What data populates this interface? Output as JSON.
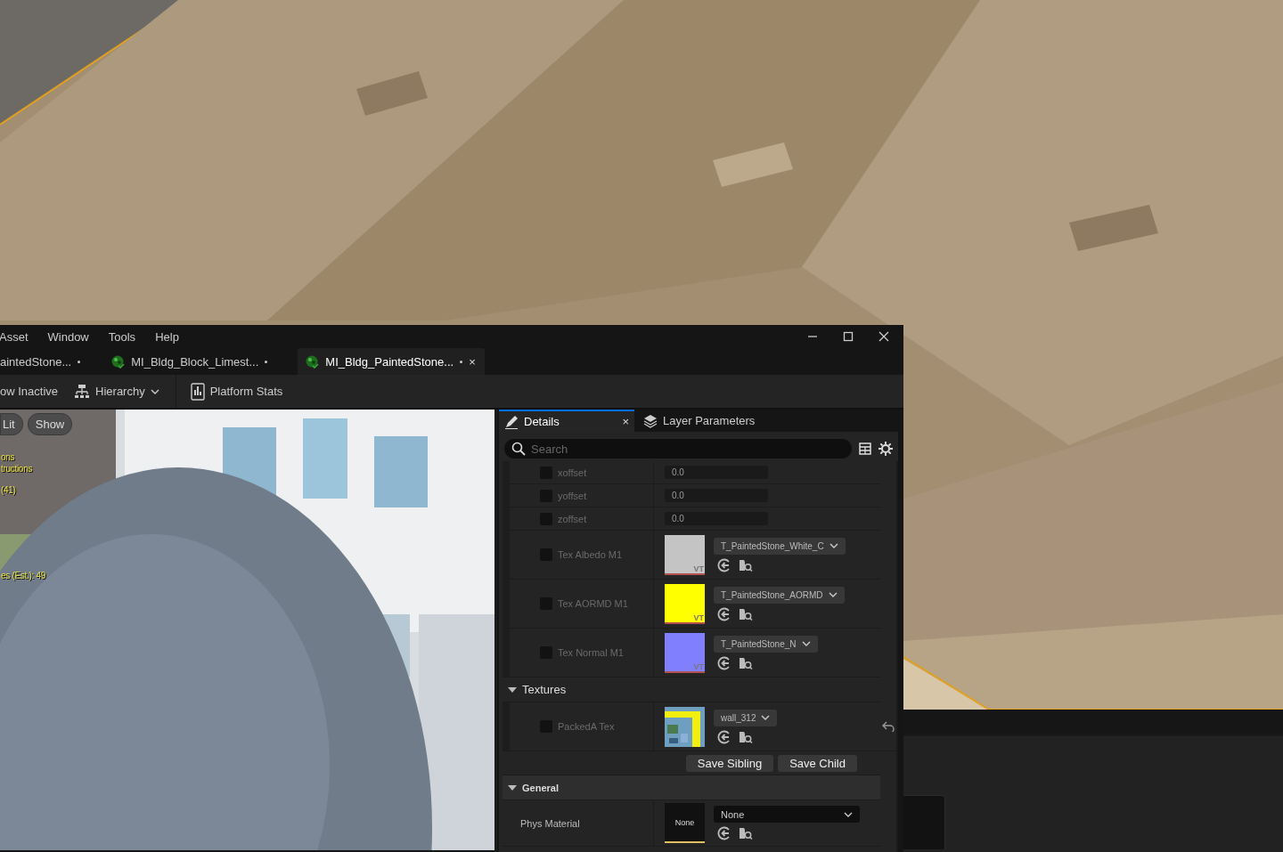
{
  "editor": {
    "menu": [
      "Asset",
      "Window",
      "Tools",
      "Help"
    ],
    "document_tabs": [
      {
        "label": "aintedStone...",
        "modified": true,
        "selected": false,
        "icon": false
      },
      {
        "label": "MI_Bldg_Block_Limest...",
        "modified": true,
        "selected": false,
        "icon": true
      },
      {
        "label": "MI_Bldg_PaintedStone...",
        "modified": true,
        "selected": true,
        "icon": true,
        "close": "×"
      }
    ],
    "toolbar": [
      {
        "label": "ow Inactive",
        "kind": "plain"
      },
      {
        "label": "Hierarchy",
        "kind": "hierarchy"
      },
      {
        "label": "Platform Stats",
        "kind": "stats"
      }
    ],
    "viewport": {
      "buttons": [
        "Lit",
        "Show"
      ],
      "stats": [
        {
          "text": "ons"
        },
        {
          "text": "tructions"
        },
        {
          "text": "(41)"
        },
        {
          "text": "es (Est.): 49"
        }
      ]
    },
    "details": {
      "tabs": [
        {
          "label": "Details",
          "selected": true,
          "close": "×",
          "kind": "details"
        },
        {
          "label": "Layer Parameters",
          "selected": false,
          "kind": "layers"
        }
      ],
      "search": {
        "placeholder": "Search"
      },
      "rows": [
        {
          "kind": "scalar",
          "label": "xoffset",
          "value": "0.0",
          "checked": false
        },
        {
          "kind": "scalar",
          "label": "yoffset",
          "value": "0.0",
          "checked": false
        },
        {
          "kind": "scalar",
          "label": "zoffset",
          "value": "0.0",
          "checked": false
        },
        {
          "kind": "texture",
          "label": "Tex Albedo M1",
          "asset": "T_PaintedStone_White_C",
          "color": "#c4c4c4",
          "badge": "VT",
          "checked": false
        },
        {
          "kind": "texture",
          "label": "Tex AORMD M1",
          "asset": "T_PaintedStone_AORMD",
          "color": "#ffff00",
          "badge": "VT",
          "checked": false
        },
        {
          "kind": "texture",
          "label": "Tex Normal M1",
          "asset": "T_PaintedStone_N",
          "color": "#8080ff",
          "badge": "VT",
          "checked": false
        },
        {
          "kind": "group",
          "label": "Textures",
          "expanded": true
        },
        {
          "kind": "packed",
          "label": "PackedA Tex",
          "asset": "wall_312",
          "checked": false,
          "reset": true
        },
        {
          "kind": "buttons",
          "buttons": [
            "Save Sibling",
            "Save Child"
          ]
        },
        {
          "kind": "group",
          "label": "General",
          "expanded": true,
          "bold": true
        },
        {
          "kind": "asset",
          "label": "Phys Material",
          "thumb": "None",
          "asset": "None"
        }
      ]
    }
  }
}
